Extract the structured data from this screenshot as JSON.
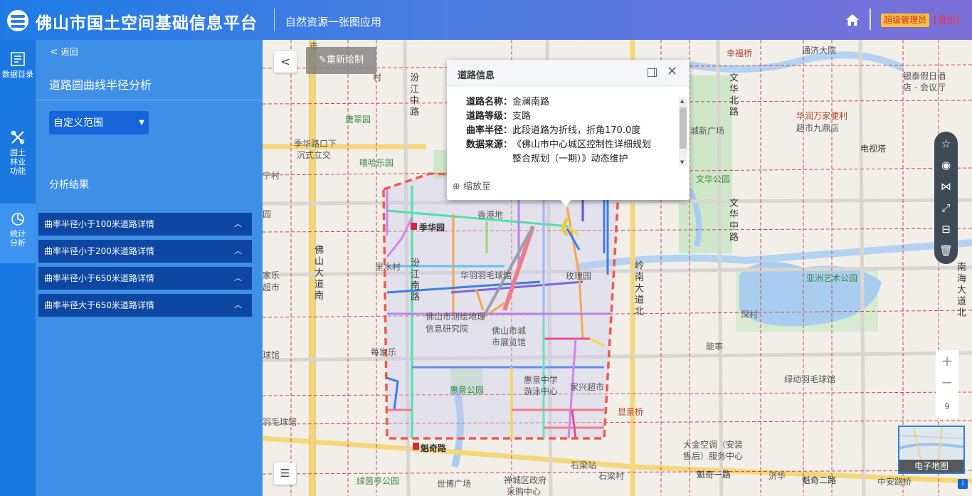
{
  "header": {
    "app_title": "佛山市国土空间基础信息平台",
    "app_subtitle": "自然资源一张图应用",
    "home_icon": "home-icon",
    "role_badge": "超级管理员",
    "logout": "[退出]"
  },
  "rail": [
    {
      "label": "数据目录",
      "icon": "data-catalog-icon"
    },
    {
      "label": "国土林业功能",
      "icon": "land-forestry-icon"
    },
    {
      "label": "统计分析",
      "icon": "pie-chart-icon"
    }
  ],
  "panel": {
    "back_label": "返回",
    "title": "道路圆曲线半径分析",
    "range_select": "自定义范围",
    "result_label": "分析结果",
    "accordion": [
      "曲率半径小于100米道路详情",
      "曲率半径小于200米道路详情",
      "曲率半径小于650米道路详情",
      "曲率半径大于650米道路详情"
    ]
  },
  "map": {
    "redraw_label": "重新绘制",
    "zoom_level": "9",
    "basemap_label": "电子地图",
    "labels": {
      "l1": "季华路口下",
      "l2": "沉式立交",
      "l3": "季华园",
      "l4": "香港地",
      "l5": "华羽羽毛球馆",
      "l6": "佛山市测绘地理",
      "l7": "信息研究院",
      "l8": "佛山市城",
      "l9": "市展览馆",
      "l10": "每家乐",
      "l11": "惠景公园",
      "l12": "惠景中学",
      "l13": "游泳中心",
      "l14": "家兴超市",
      "l15": "魁奇路",
      "l16": "石梁站",
      "l17": "石梁村",
      "l18": "禅城区政府",
      "l19": "采购中心",
      "l20": "世博广场",
      "l21": "绿茵亭公园",
      "l22": "文华公园",
      "l23": "亚洲艺术公园",
      "l24": "深村",
      "l25": "能率",
      "l26": "绿动羽毛球馆",
      "l27": "大金空调（安装",
      "l28": "售后）服务中心",
      "l29": "幸福桥",
      "l30": "通济大院",
      "l31": "银泰假日酒",
      "l32": "店 - 会议厅",
      "l33": "华润万家便利",
      "l34": "超市九鼎店",
      "l35": "电视塔",
      "l36": "嘻哈乐园",
      "l37": "唐翠园",
      "l38": "玫瑰园",
      "l39": "里水村",
      "l40": "城新广场",
      "l41": "显景桥",
      "l42": "中安路桥",
      "l43": "魁奇一路",
      "l44": "魁奇二路",
      "l45": "济华",
      "l46": "羽毛球馆",
      "l47": "球馆",
      "l48": "家乐",
      "l49": "超市",
      "l50": "宁村",
      "l51": "村",
      "l52": "园",
      "l53": "市",
      "r1": "汾江中路",
      "r2": "佛山大道南",
      "r3": "汾江南路",
      "r4": "岭南大道北",
      "r5": "文华北路",
      "r6": "文华中路",
      "r7": "南海大道北"
    }
  },
  "popup": {
    "title": "道路信息",
    "rows": [
      {
        "k": "道路名称：",
        "v": "金澜南路"
      },
      {
        "k": "道路等级：",
        "v": "支路"
      },
      {
        "k": "曲率半径：",
        "v": "此段道路为折线，折角170.0度"
      },
      {
        "k": "数据来源：",
        "v": "《佛山市中心城区控制性详细规划整合规划（一期）》动态维护"
      }
    ],
    "zoom_to": "缩放至"
  },
  "toolbar": [
    "star-icon",
    "globe-icon",
    "compare-icon",
    "fullscreen-icon",
    "layers-icon",
    "trash-icon"
  ]
}
